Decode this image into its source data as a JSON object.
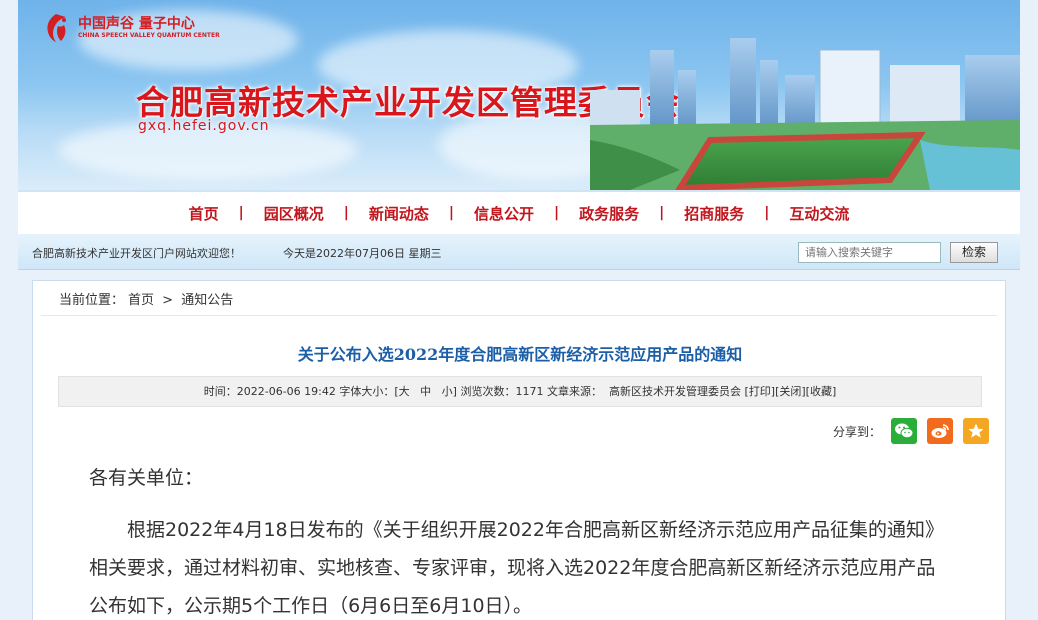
{
  "header": {
    "logo_cn": "中国声谷 量子中心",
    "logo_en": "CHINA SPEECH VALLEY QUANTUM CENTER",
    "site_title": "合肥高新技术产业开发区管理委员会",
    "site_domain": "gxq.hefei.gov.cn"
  },
  "nav": {
    "items": [
      {
        "label": "首页"
      },
      {
        "label": "园区概况"
      },
      {
        "label": "新闻动态"
      },
      {
        "label": "信息公开"
      },
      {
        "label": "政务服务"
      },
      {
        "label": "招商服务"
      },
      {
        "label": "互动交流"
      }
    ],
    "separator": "|"
  },
  "infobar": {
    "welcome": "合肥高新技术产业开发区门户网站欢迎您！",
    "today": "今天是2022年07月06日  星期三",
    "search_placeholder": "请输入搜索关键字",
    "search_button": "检索"
  },
  "breadcrumb": {
    "prefix": "当前位置：",
    "home": "首页",
    "sep": ">",
    "current": "通知公告"
  },
  "article": {
    "title": "关于公布入选2022年度合肥高新区新经济示范应用产品的通知",
    "meta": {
      "time_label": "时间：",
      "time": "2022-06-06 19:42",
      "font_label": "字体大小：",
      "font_open": "[",
      "font_large": "大",
      "font_medium": "中",
      "font_small": "小",
      "font_close": "]",
      "views_label": "浏览次数：",
      "views": "1171",
      "source_label": "文章来源：",
      "source": "高新区技术开发管理委员会",
      "print": "[打印]",
      "close": "[关闭]",
      "favorite": "[收藏]"
    },
    "share_label": "分享到：",
    "greeting": "各有关单位：",
    "body": "根据2022年4月18日发布的《关于组织开展2022年合肥高新区新经济示范应用产品征集的通知》相关要求，通过材料初审、实地核查、专家评审，现将入选2022年度合肥高新区新经济示范应用产品公布如下，公示期5个工作日（6月6日至6月10日）。"
  },
  "colors": {
    "brand_red": "#d8161c",
    "title_blue": "#1d5fa6",
    "wechat_green": "#2aae3a",
    "weibo_orange": "#f26b1d",
    "fav_orange": "#f5a623"
  }
}
